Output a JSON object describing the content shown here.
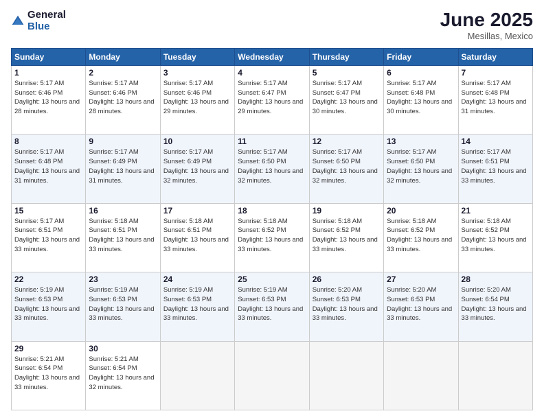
{
  "header": {
    "logo_line1": "General",
    "logo_line2": "Blue",
    "month": "June 2025",
    "location": "Mesillas, Mexico"
  },
  "weekdays": [
    "Sunday",
    "Monday",
    "Tuesday",
    "Wednesday",
    "Thursday",
    "Friday",
    "Saturday"
  ],
  "weeks": [
    [
      {
        "day": "1",
        "sunrise": "5:17 AM",
        "sunset": "6:46 PM",
        "daylight": "13 hours and 28 minutes."
      },
      {
        "day": "2",
        "sunrise": "5:17 AM",
        "sunset": "6:46 PM",
        "daylight": "13 hours and 28 minutes."
      },
      {
        "day": "3",
        "sunrise": "5:17 AM",
        "sunset": "6:46 PM",
        "daylight": "13 hours and 29 minutes."
      },
      {
        "day": "4",
        "sunrise": "5:17 AM",
        "sunset": "6:47 PM",
        "daylight": "13 hours and 29 minutes."
      },
      {
        "day": "5",
        "sunrise": "5:17 AM",
        "sunset": "6:47 PM",
        "daylight": "13 hours and 30 minutes."
      },
      {
        "day": "6",
        "sunrise": "5:17 AM",
        "sunset": "6:48 PM",
        "daylight": "13 hours and 30 minutes."
      },
      {
        "day": "7",
        "sunrise": "5:17 AM",
        "sunset": "6:48 PM",
        "daylight": "13 hours and 31 minutes."
      }
    ],
    [
      {
        "day": "8",
        "sunrise": "5:17 AM",
        "sunset": "6:48 PM",
        "daylight": "13 hours and 31 minutes."
      },
      {
        "day": "9",
        "sunrise": "5:17 AM",
        "sunset": "6:49 PM",
        "daylight": "13 hours and 31 minutes."
      },
      {
        "day": "10",
        "sunrise": "5:17 AM",
        "sunset": "6:49 PM",
        "daylight": "13 hours and 32 minutes."
      },
      {
        "day": "11",
        "sunrise": "5:17 AM",
        "sunset": "6:50 PM",
        "daylight": "13 hours and 32 minutes."
      },
      {
        "day": "12",
        "sunrise": "5:17 AM",
        "sunset": "6:50 PM",
        "daylight": "13 hours and 32 minutes."
      },
      {
        "day": "13",
        "sunrise": "5:17 AM",
        "sunset": "6:50 PM",
        "daylight": "13 hours and 32 minutes."
      },
      {
        "day": "14",
        "sunrise": "5:17 AM",
        "sunset": "6:51 PM",
        "daylight": "13 hours and 33 minutes."
      }
    ],
    [
      {
        "day": "15",
        "sunrise": "5:17 AM",
        "sunset": "6:51 PM",
        "daylight": "13 hours and 33 minutes."
      },
      {
        "day": "16",
        "sunrise": "5:18 AM",
        "sunset": "6:51 PM",
        "daylight": "13 hours and 33 minutes."
      },
      {
        "day": "17",
        "sunrise": "5:18 AM",
        "sunset": "6:51 PM",
        "daylight": "13 hours and 33 minutes."
      },
      {
        "day": "18",
        "sunrise": "5:18 AM",
        "sunset": "6:52 PM",
        "daylight": "13 hours and 33 minutes."
      },
      {
        "day": "19",
        "sunrise": "5:18 AM",
        "sunset": "6:52 PM",
        "daylight": "13 hours and 33 minutes."
      },
      {
        "day": "20",
        "sunrise": "5:18 AM",
        "sunset": "6:52 PM",
        "daylight": "13 hours and 33 minutes."
      },
      {
        "day": "21",
        "sunrise": "5:18 AM",
        "sunset": "6:52 PM",
        "daylight": "13 hours and 33 minutes."
      }
    ],
    [
      {
        "day": "22",
        "sunrise": "5:19 AM",
        "sunset": "6:53 PM",
        "daylight": "13 hours and 33 minutes."
      },
      {
        "day": "23",
        "sunrise": "5:19 AM",
        "sunset": "6:53 PM",
        "daylight": "13 hours and 33 minutes."
      },
      {
        "day": "24",
        "sunrise": "5:19 AM",
        "sunset": "6:53 PM",
        "daylight": "13 hours and 33 minutes."
      },
      {
        "day": "25",
        "sunrise": "5:19 AM",
        "sunset": "6:53 PM",
        "daylight": "13 hours and 33 minutes."
      },
      {
        "day": "26",
        "sunrise": "5:20 AM",
        "sunset": "6:53 PM",
        "daylight": "13 hours and 33 minutes."
      },
      {
        "day": "27",
        "sunrise": "5:20 AM",
        "sunset": "6:53 PM",
        "daylight": "13 hours and 33 minutes."
      },
      {
        "day": "28",
        "sunrise": "5:20 AM",
        "sunset": "6:54 PM",
        "daylight": "13 hours and 33 minutes."
      }
    ],
    [
      {
        "day": "29",
        "sunrise": "5:21 AM",
        "sunset": "6:54 PM",
        "daylight": "13 hours and 33 minutes."
      },
      {
        "day": "30",
        "sunrise": "5:21 AM",
        "sunset": "6:54 PM",
        "daylight": "13 hours and 32 minutes."
      },
      null,
      null,
      null,
      null,
      null
    ]
  ]
}
